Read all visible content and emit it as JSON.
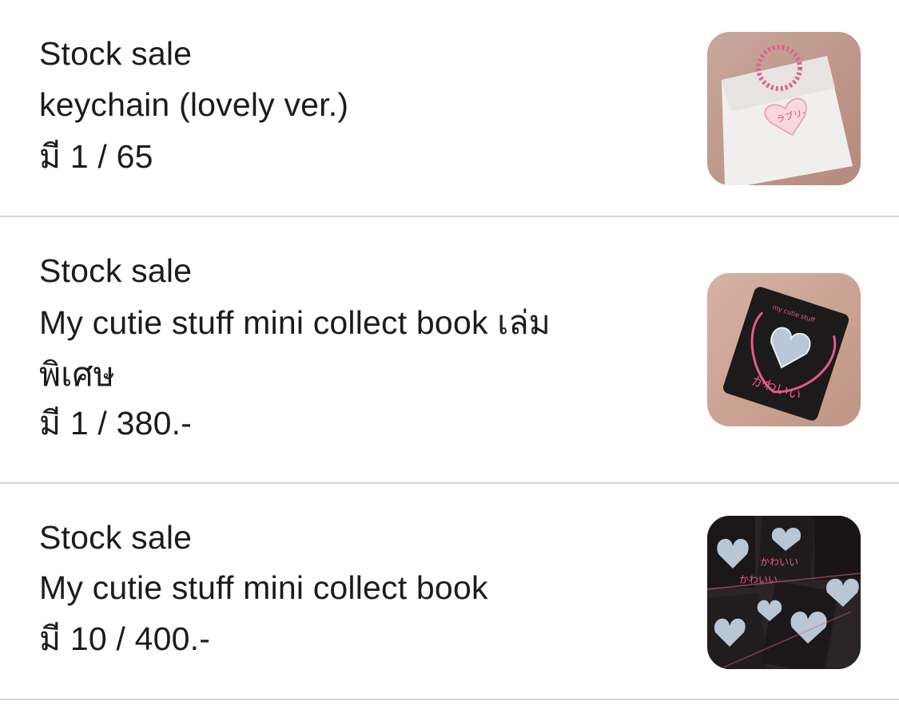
{
  "items": [
    {
      "category": "Stock sale",
      "title_line1": "keychain (lovely ver.)",
      "title_line2": "",
      "stock_price": "มี 1 / 65",
      "thumbnail": "keychain-photo"
    },
    {
      "category": "Stock sale",
      "title_line1": "My cutie stuff mini collect book เล่ม",
      "title_line2": "พิเศษ",
      "stock_price": "มี 1 / 380.-",
      "thumbnail": "collect-book-special-photo"
    },
    {
      "category": "Stock sale",
      "title_line1": "My cutie stuff mini collect book",
      "title_line2": "",
      "stock_price": "มี 10 / 400.-",
      "thumbnail": "collect-books-pile-photo"
    }
  ],
  "colors": {
    "text": "#1c1c1e",
    "divider": "#d6d6d8",
    "background": "#ffffff"
  }
}
